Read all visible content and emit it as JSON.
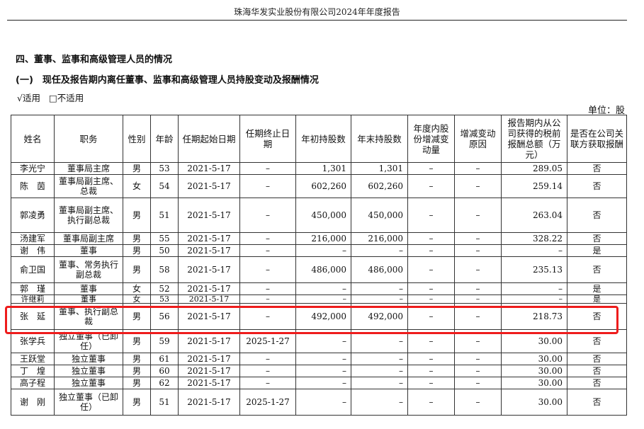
{
  "header": {
    "title": "珠海华发实业股份有限公司2024年年度报告"
  },
  "section": {
    "title": "四、董事、监事和高级管理人员的情况",
    "subtitle": "(一)　现任及报告期内离任董事、监事和高级管理人员持股变动及报酬情况",
    "option_applicable": "√适用",
    "option_not_applicable": "□不适用",
    "unit": "单位：股"
  },
  "table": {
    "headers": [
      "姓名",
      "职务",
      "性别",
      "年龄",
      "任期起始日期",
      "任期终止日期",
      "年初持股数",
      "年末持股数",
      "年度内股份增减变动量",
      "增减变动原因",
      "报告期内从公司获得的税前报酬总额（万元）",
      "是否在公司关联方获取报酬"
    ],
    "rows": [
      [
        "李光宁",
        "董事局主席",
        "男",
        "53",
        "2021-5-17",
        "–",
        "1,301",
        "1,301",
        "–",
        "–",
        "289.05",
        "否"
      ],
      [
        "陈　茵",
        "董事局副主席、总裁",
        "女",
        "54",
        "2021-5-17",
        "–",
        "602,260",
        "602,260",
        "–",
        "–",
        "259.14",
        "否"
      ],
      [
        "郭凌勇",
        "董事局副主席、执行副总裁",
        "男",
        "51",
        "2021-5-17",
        "–",
        "450,000",
        "450,000",
        "–",
        "–",
        "263.04",
        "否"
      ],
      [
        "汤建军",
        "董事局副主席",
        "男",
        "55",
        "2021-5-17",
        "–",
        "216,000",
        "216,000",
        "–",
        "–",
        "328.22",
        "否"
      ],
      [
        "谢　伟",
        "董事",
        "男",
        "50",
        "2021-5-17",
        "–",
        "–",
        "–",
        "–",
        "–",
        "–",
        "是"
      ],
      [
        "俞卫国",
        "董事、常务执行副总裁",
        "男",
        "58",
        "2021-5-17",
        "–",
        "486,000",
        "486,000",
        "–",
        "–",
        "235.13",
        "否"
      ],
      [
        "郭　瑾",
        "董事",
        "女",
        "52",
        "2021-5-17",
        "–",
        "–",
        "–",
        "–",
        "–",
        "–",
        "是"
      ],
      [
        "许继莉",
        "董事",
        "女",
        "53",
        "2021-5-17",
        "–",
        "–",
        "–",
        "–",
        "–",
        "–",
        "是"
      ],
      [
        "张　延",
        "董事、执行副总裁",
        "男",
        "56",
        "2021-5-17",
        "–",
        "492,000",
        "492,000",
        "–",
        "–",
        "218.73",
        "否"
      ],
      [
        "张学兵",
        "独立董事（已卸任）",
        "男",
        "59",
        "2021-5-17",
        "2025-1-27",
        "–",
        "–",
        "–",
        "–",
        "30.00",
        "否"
      ],
      [
        "王跃堂",
        "独立董事",
        "男",
        "61",
        "2021-5-17",
        "–",
        "–",
        "–",
        "–",
        "–",
        "30.00",
        "否"
      ],
      [
        "丁　煌",
        "独立董事",
        "男",
        "60",
        "2021-5-17",
        "–",
        "–",
        "–",
        "–",
        "–",
        "30.00",
        "否"
      ],
      [
        "高子程",
        "独立董事",
        "男",
        "62",
        "2021-5-17",
        "–",
        "–",
        "–",
        "–",
        "–",
        "30.00",
        "否"
      ],
      [
        "谢　刚",
        "独立董事（已卸任）",
        "男",
        "51",
        "2021-5-17",
        "2025-1-27",
        "–",
        "–",
        "–",
        "–",
        "30.00",
        "否"
      ]
    ]
  },
  "highlight": {
    "color": "#ee1c1c",
    "row_name": "张　延"
  }
}
